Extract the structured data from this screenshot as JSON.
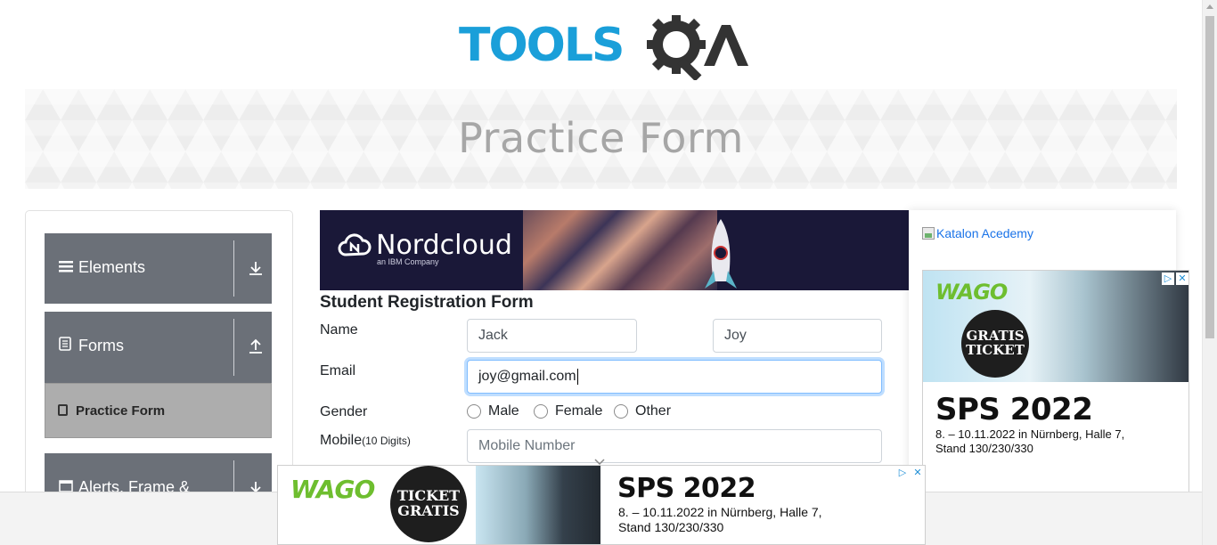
{
  "header": {
    "logo_text": "TOOLSQA"
  },
  "banner": {
    "title": "Practice Form"
  },
  "sidebar": {
    "groups": [
      {
        "label": "Elements",
        "icon": "download-arrow-icon"
      },
      {
        "label": "Forms",
        "icon": "upload-arrow-icon"
      },
      {
        "label": "Alerts, Frame &",
        "icon": "download-arrow-icon"
      }
    ],
    "active_item": {
      "label": "Practice Form"
    }
  },
  "top_ad": {
    "brand": "Nordcloud",
    "sub": "an IBM Company"
  },
  "form": {
    "title": "Student Registration Form",
    "name_label": "Name",
    "first_name": "Jack",
    "last_name": "Joy",
    "email_label": "Email",
    "email_value": "joy@gmail.com",
    "gender_label": "Gender",
    "gender_options": [
      "Male",
      "Female",
      "Other"
    ],
    "mobile_label": "Mobile",
    "mobile_hint": "(10 Digits)",
    "mobile_placeholder": "Mobile Number"
  },
  "right_panel": {
    "link_text": "Katalon Acedemy"
  },
  "right_ad": {
    "brand": "WAGO",
    "ticket": "GRATIS TICKET",
    "title": "SPS 2022",
    "line1": "8. – 10.11.2022 in Nürnberg, Halle 7,",
    "line2": "Stand 130/230/330"
  },
  "bottom_ad": {
    "brand": "WAGO",
    "ticket": "TICKET GRATIS",
    "title": "SPS 2022",
    "line1": "8. – 10.11.2022 in Nürnberg, Halle 7,",
    "line2": "Stand 130/230/330"
  },
  "colors": {
    "accent_blue": "#1a9fd9",
    "sidebar_gray": "#6b7078",
    "wago_green": "#6ebe2f"
  }
}
